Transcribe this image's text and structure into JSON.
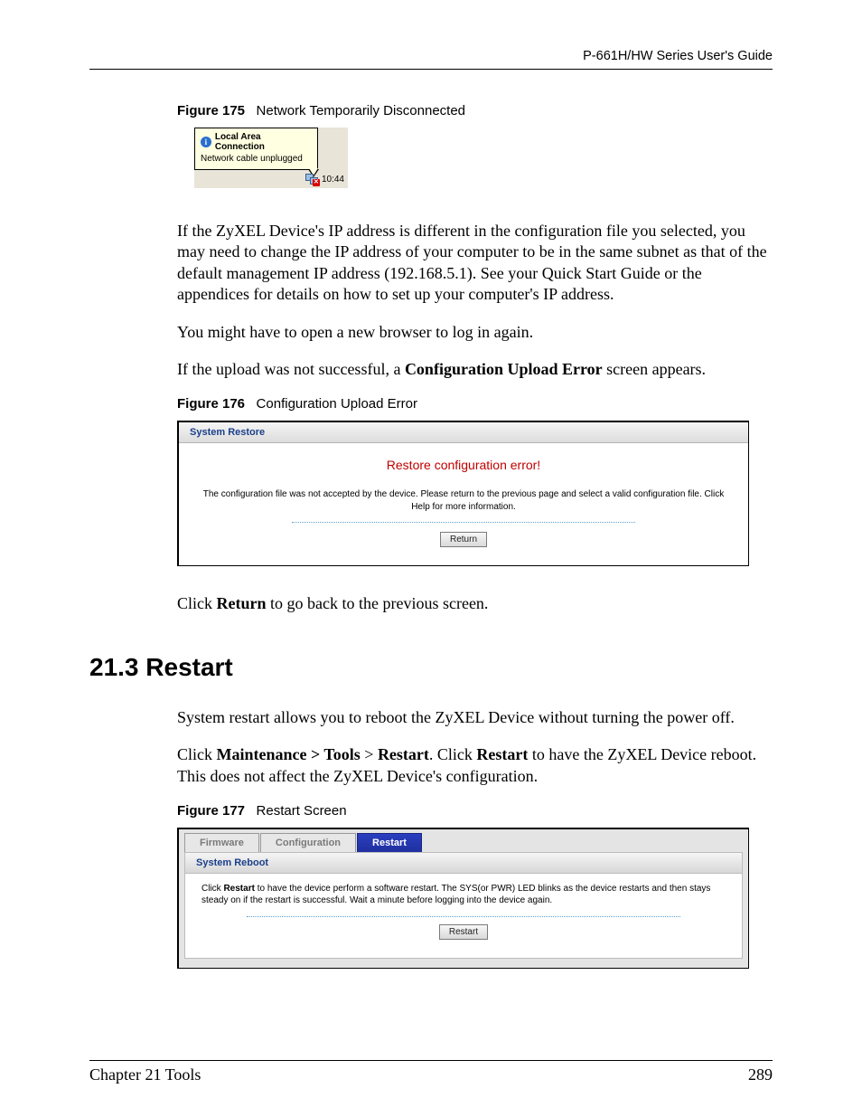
{
  "header": {
    "guide_title": "P-661H/HW Series User's Guide"
  },
  "figure175": {
    "caption_label": "Figure 175",
    "caption_text": "Network Temporarily Disconnected",
    "balloon_title": "Local Area Connection",
    "balloon_subtitle": "Network cable unplugged",
    "tray_time": "10:44"
  },
  "para1": "If the ZyXEL Device's IP address is different in the configuration file you selected, you may need to change the IP address of your computer to be in the same subnet as that of the default management IP address (192.168.5.1). See your Quick Start Guide or the appendices for details on how to set up your computer's IP address.",
  "para2": "You might have to open a new browser to log in again.",
  "para3_pre": "If the upload was not successful, a ",
  "para3_bold": "Configuration Upload Error",
  "para3_post": " screen appears.",
  "figure176": {
    "caption_label": "Figure 176",
    "caption_text": "Configuration Upload Error",
    "panel_title": "System Restore",
    "error_heading": "Restore configuration error!",
    "error_desc": "The configuration file was not accepted by the device. Please return to the previous page and select a valid configuration file. Click Help for more information.",
    "return_button": "Return"
  },
  "para4_pre": "Click ",
  "para4_bold": "Return",
  "para4_post": " to go back to the previous screen.",
  "section": {
    "number_title": "21.3  Restart"
  },
  "para5": "System restart allows you to reboot the ZyXEL Device without turning the power off.",
  "para6": {
    "t1": "Click ",
    "b1": "Maintenance > Tools",
    "t2": " > ",
    "b2": "Restart",
    "t3": ". Click ",
    "b3": "Restart",
    "t4": " to have the ZyXEL Device reboot. This does not affect the ZyXEL Device's configuration."
  },
  "figure177": {
    "caption_label": "Figure 177",
    "caption_text": "Restart Screen",
    "tabs": {
      "firmware": "Firmware",
      "configuration": "Configuration",
      "restart": "Restart"
    },
    "panel_title": "System Reboot",
    "desc_t1": "Click ",
    "desc_b1": "Restart",
    "desc_t2": " to have the device perform a software restart. The SYS(or PWR) LED blinks as the device restarts and then stays steady on if the restart is successful. Wait a minute before logging into the device again.",
    "restart_button": "Restart"
  },
  "footer": {
    "chapter": "Chapter 21 Tools",
    "page": "289"
  }
}
